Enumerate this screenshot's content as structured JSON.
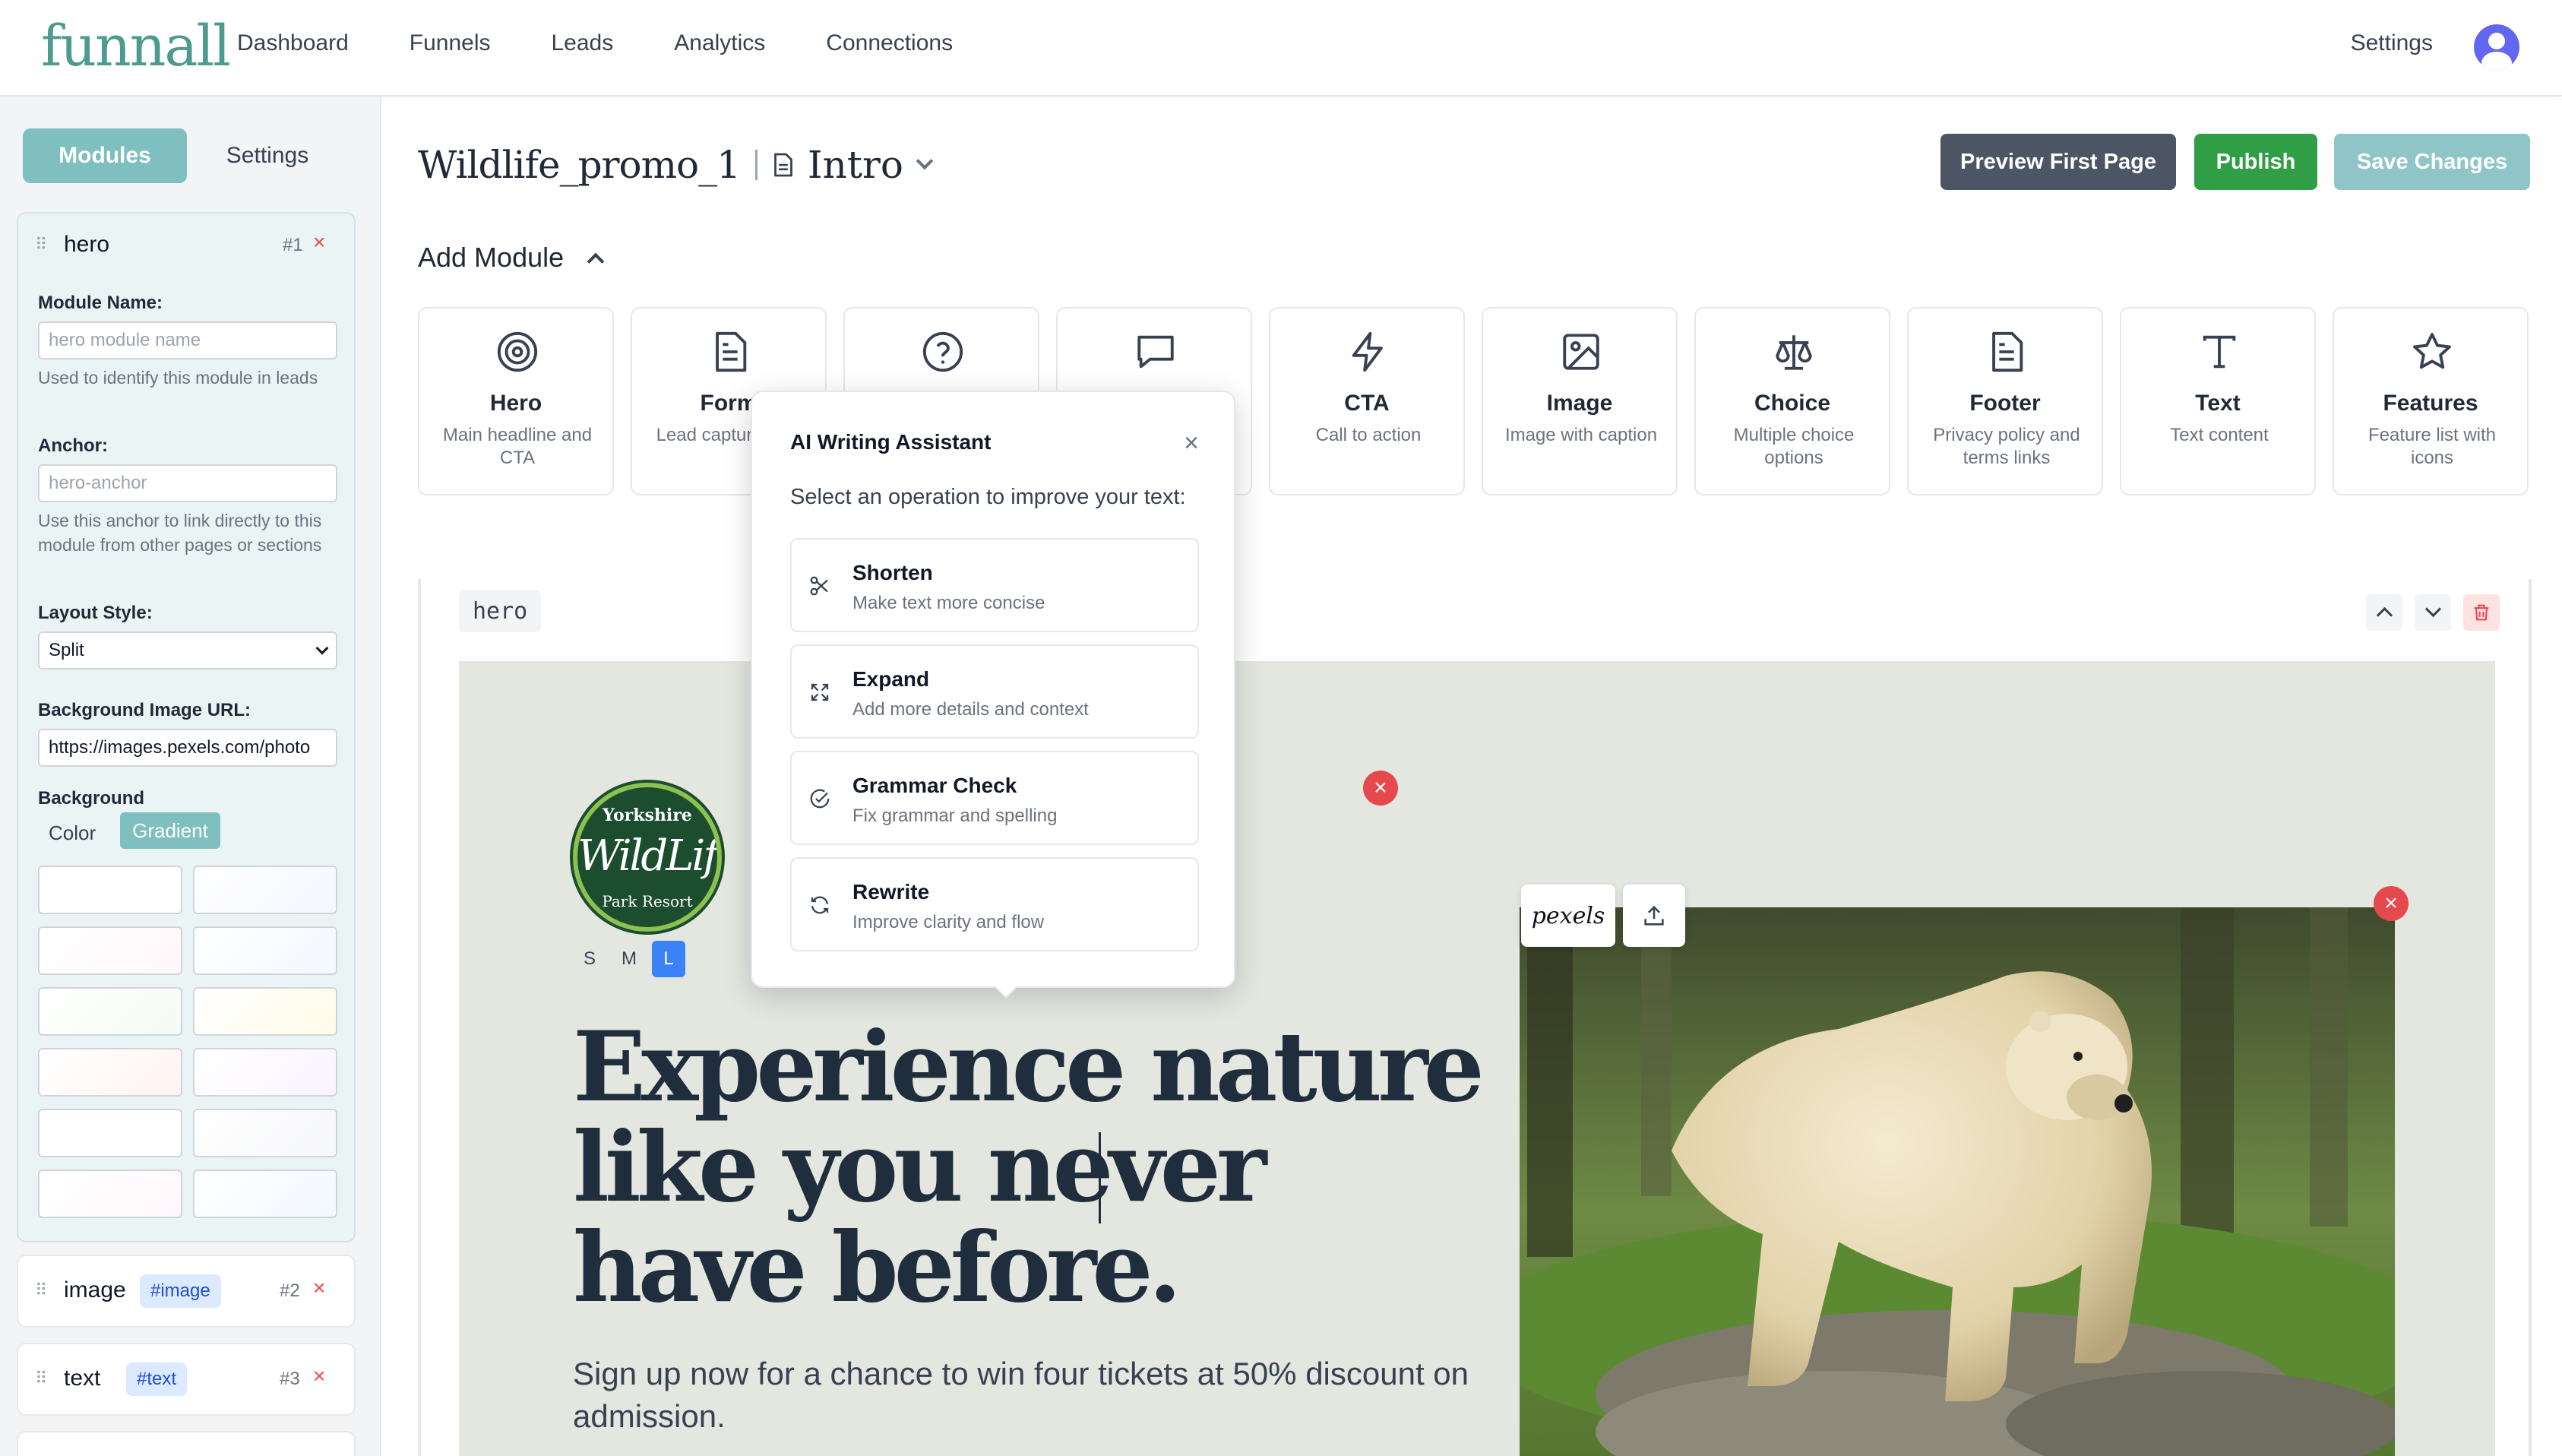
{
  "app": {
    "logo": "funnall"
  },
  "nav": {
    "links": [
      "Dashboard",
      "Funnels",
      "Leads",
      "Analytics",
      "Connections"
    ],
    "settings": "Settings"
  },
  "sidebar": {
    "tabs": {
      "modules": "Modules",
      "settings": "Settings"
    },
    "hero": {
      "title": "hero",
      "number": "#1",
      "remove": "×",
      "module_name_label": "Module Name:",
      "module_name_placeholder": "hero module name",
      "module_name_help": "Used to identify this module in leads",
      "anchor_label": "Anchor:",
      "anchor_placeholder": "hero-anchor",
      "anchor_help": "Use this anchor to link directly to this module from other pages or sections",
      "layout_label": "Layout Style:",
      "layout_value": "Split",
      "bg_url_label": "Background Image URL:",
      "bg_url_value": "https://images.pexels.com/photo",
      "background_label": "Background",
      "bg_color_option": "Color",
      "bg_gradient_option": "Gradient"
    },
    "gradient_swatches": [
      "#ffffff",
      "#f5f7ff",
      "#fff7fa",
      "#f3f8ff",
      "#f4fbf3",
      "#fffbe8",
      "#fff4f2",
      "#f9f4ff",
      "#ffffff",
      "#f6f7f9",
      "#fff7fb",
      "#f2f8ff"
    ],
    "other_modules": [
      {
        "title": "image",
        "tag": "#image",
        "number": "#2",
        "remove": "×"
      },
      {
        "title": "text",
        "tag": "#text",
        "number": "#3",
        "remove": "×"
      }
    ]
  },
  "header": {
    "funnel_name": "Wildlife_promo_1",
    "page_name": "Intro",
    "buttons": {
      "preview": "Preview First Page",
      "publish": "Publish",
      "save": "Save Changes"
    }
  },
  "add_module": {
    "title": "Add Module",
    "modules": [
      {
        "name": "Hero",
        "desc": "Main headline and CTA",
        "icon": "target-icon"
      },
      {
        "name": "Form",
        "desc": "Lead capture form",
        "icon": "document-icon"
      },
      {
        "name": "",
        "desc": "",
        "icon": "question-icon"
      },
      {
        "name": "",
        "desc": "",
        "icon": "speech-bubble-icon"
      },
      {
        "name": "CTA",
        "desc": "Call to action",
        "icon": "lightning-icon"
      },
      {
        "name": "Image",
        "desc": "Image with caption",
        "icon": "image-icon"
      },
      {
        "name": "Choice",
        "desc": "Multiple choice options",
        "icon": "scales-icon"
      },
      {
        "name": "Footer",
        "desc": "Privacy policy and terms links",
        "icon": "document-icon"
      },
      {
        "name": "Text",
        "desc": "Text content",
        "icon": "text-t-icon"
      },
      {
        "name": "Features",
        "desc": "Feature list with icons",
        "icon": "star-icon"
      }
    ]
  },
  "editor": {
    "module_tag": "hero",
    "hero": {
      "logo_line1": "Yorkshire",
      "logo_line2": "WildLife",
      "logo_line3": "Park Resort",
      "sizes": [
        "S",
        "M",
        "L"
      ],
      "selected_size": "L",
      "headline": "Experience nature like you never have before.",
      "subline": "Sign up now for a chance to win four tickets at 50% discount on admission.",
      "pexels_label": "pexels",
      "remove": "×"
    }
  },
  "ai_assistant": {
    "title": "AI Writing Assistant",
    "close": "×",
    "description": "Select an operation to improve your text:",
    "operations": [
      {
        "title": "Shorten",
        "desc": "Make text more concise",
        "icon": "scissors-icon"
      },
      {
        "title": "Expand",
        "desc": "Add more details and context",
        "icon": "expand-arrows-icon"
      },
      {
        "title": "Grammar Check",
        "desc": "Fix grammar and spelling",
        "icon": "check-circle-icon"
      },
      {
        "title": "Rewrite",
        "desc": "Improve clarity and flow",
        "icon": "refresh-icon"
      }
    ]
  },
  "colors": {
    "brand": "#4d9a8f",
    "accent": "#7fbfc0",
    "publish": "#2f9e44",
    "preview": "#4b5563",
    "danger": "#e5484d"
  }
}
